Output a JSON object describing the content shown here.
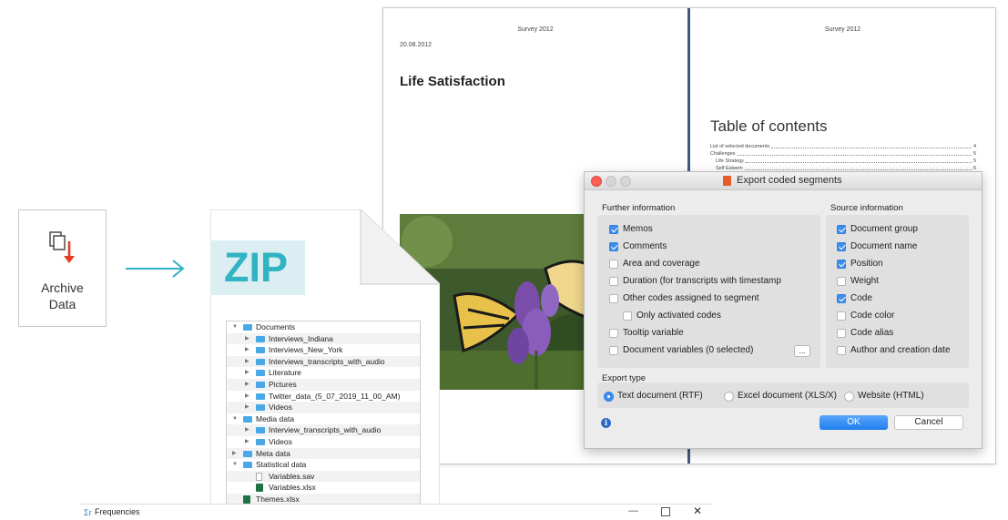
{
  "archive": {
    "line1": "Archive",
    "line2": "Data"
  },
  "report": {
    "left_header": "Survey 2012",
    "right_header": "Survey 2012",
    "date": "20.08.2012",
    "title": "Life Satisfaction",
    "toc_title": "Table of contents",
    "toc": [
      {
        "label": "List of selected documents",
        "page": "4"
      },
      {
        "label": "Challenges",
        "page": "5"
      },
      {
        "label": "Life Strategy",
        "page": "5"
      },
      {
        "label": "Self Esteem",
        "page": "6"
      }
    ]
  },
  "zip": {
    "label": "ZIP",
    "tree": [
      {
        "label": "Documents",
        "level": 0,
        "kind": "folder",
        "toggle": "open"
      },
      {
        "label": "Interviews_Indiana",
        "level": 1,
        "kind": "folder",
        "toggle": "closed"
      },
      {
        "label": "Interviews_New_York",
        "level": 1,
        "kind": "folder",
        "toggle": "closed"
      },
      {
        "label": "Interviews_transcripts_with_audio",
        "level": 1,
        "kind": "folder",
        "toggle": "closed"
      },
      {
        "label": "Literature",
        "level": 1,
        "kind": "folder",
        "toggle": "closed"
      },
      {
        "label": "Pictures",
        "level": 1,
        "kind": "folder",
        "toggle": "closed"
      },
      {
        "label": "Twitter_data_(5_07_2019_11_00_AM)",
        "level": 1,
        "kind": "folder",
        "toggle": "closed"
      },
      {
        "label": "Videos",
        "level": 1,
        "kind": "folder",
        "toggle": "closed"
      },
      {
        "label": "Media data",
        "level": 0,
        "kind": "folder",
        "toggle": "open"
      },
      {
        "label": "Interview_transcripts_with_audio",
        "level": 1,
        "kind": "folder",
        "toggle": "closed"
      },
      {
        "label": "Videos",
        "level": 1,
        "kind": "folder",
        "toggle": "closed"
      },
      {
        "label": "Meta data",
        "level": 0,
        "kind": "folder",
        "toggle": "closed"
      },
      {
        "label": "Statistical data",
        "level": 0,
        "kind": "folder",
        "toggle": "open"
      },
      {
        "label": "Variables.sav",
        "level": 1,
        "kind": "file",
        "toggle": ""
      },
      {
        "label": "Variables.xlsx",
        "level": 1,
        "kind": "xls",
        "toggle": ""
      },
      {
        "label": "Themes.xlsx",
        "level": 0,
        "kind": "xls",
        "toggle": ""
      }
    ]
  },
  "freq_window": {
    "title": "Frequencies",
    "minimize": "—",
    "close": "✕"
  },
  "dialog": {
    "title": "Export coded segments",
    "further_label": "Further information",
    "source_label": "Source information",
    "further_options": [
      {
        "label": "Memos",
        "checked": true,
        "indent": false
      },
      {
        "label": "Comments",
        "checked": true,
        "indent": false
      },
      {
        "label": "Area and coverage",
        "checked": false,
        "indent": false
      },
      {
        "label": "Duration (for transcripts with timestamp",
        "checked": false,
        "indent": false
      },
      {
        "label": "Other codes assigned to segment",
        "checked": false,
        "indent": false
      },
      {
        "label": "Only activated codes",
        "checked": false,
        "indent": true
      },
      {
        "label": "Tooltip variable",
        "checked": false,
        "indent": false
      },
      {
        "label": "Document variables (0 selected)",
        "checked": false,
        "indent": false
      }
    ],
    "dots_label": "...",
    "source_options": [
      {
        "label": "Document group",
        "checked": true
      },
      {
        "label": "Document name",
        "checked": true
      },
      {
        "label": "Position",
        "checked": true
      },
      {
        "label": "Weight",
        "checked": false
      },
      {
        "label": "Code",
        "checked": true
      },
      {
        "label": "Code color",
        "checked": false
      },
      {
        "label": "Code alias",
        "checked": false
      },
      {
        "label": "Author and creation date",
        "checked": false
      }
    ],
    "export_type_label": "Export type",
    "export_types": [
      {
        "label": "Text document (RTF)",
        "selected": true
      },
      {
        "label": "Excel document (XLS/X)",
        "selected": false
      },
      {
        "label": "Website (HTML)",
        "selected": false
      }
    ],
    "info_glyph": "i",
    "ok_label": "OK",
    "cancel_label": "Cancel"
  }
}
